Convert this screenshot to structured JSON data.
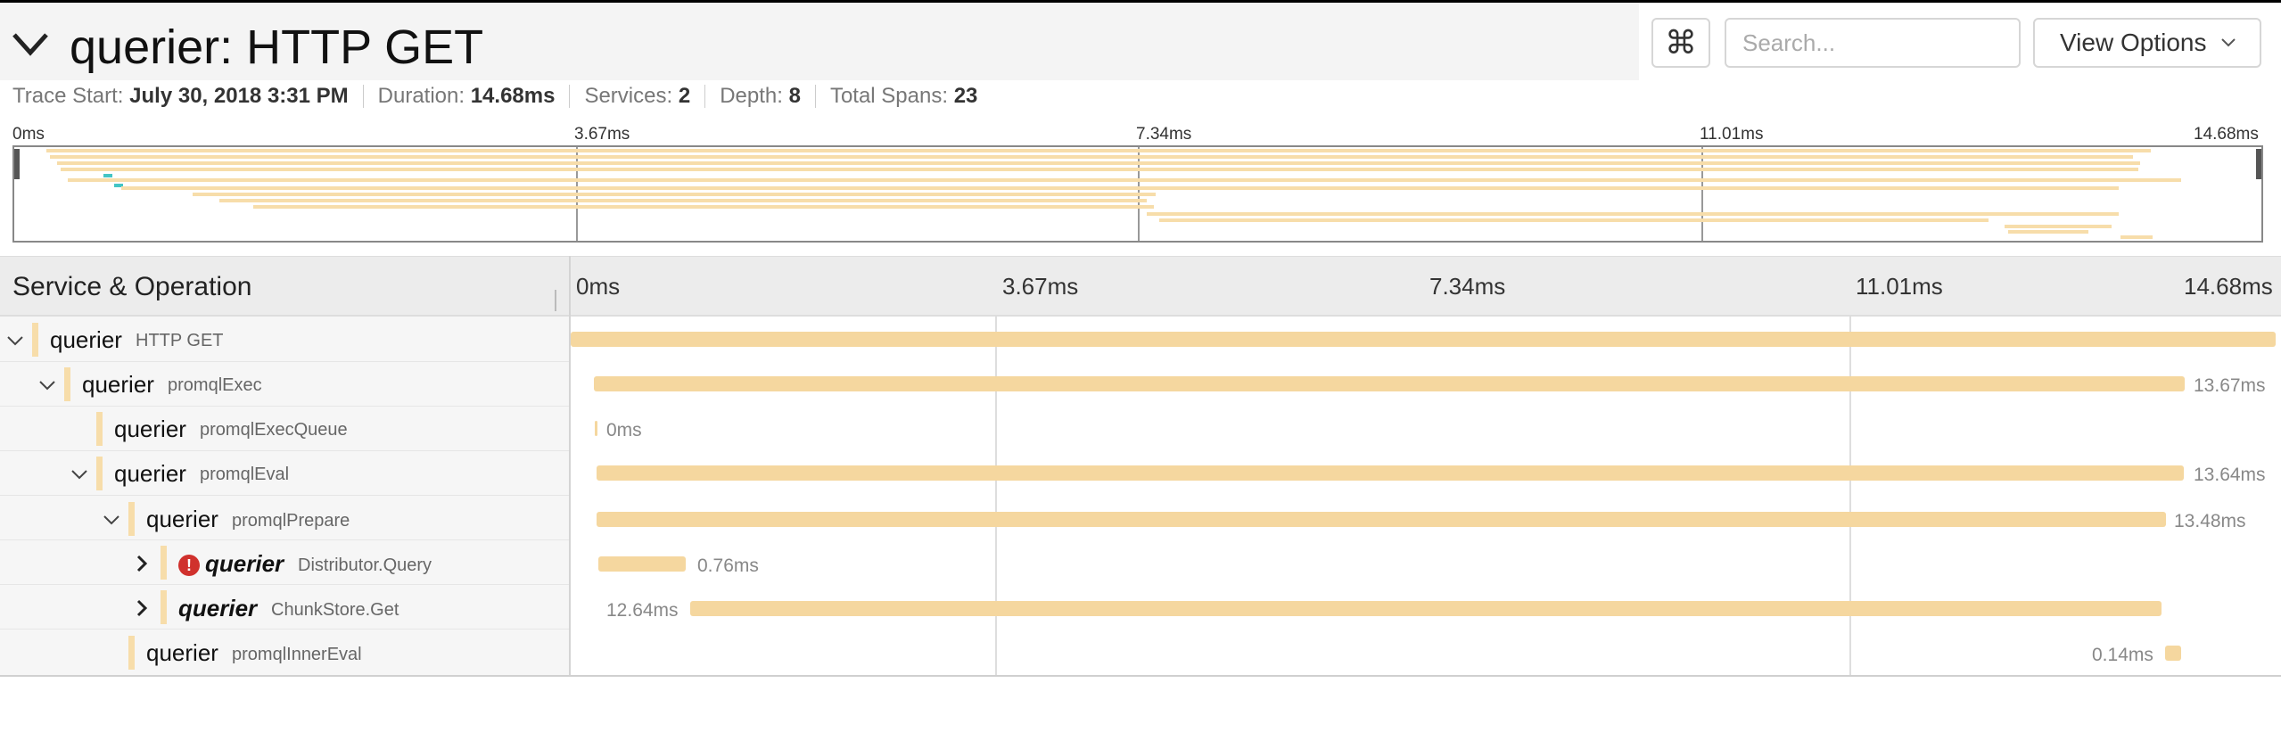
{
  "trace": {
    "title": "querier: HTTP GET",
    "meta": [
      {
        "label": "Trace Start:",
        "value": "July 30, 2018 3:31 PM"
      },
      {
        "label": "Duration:",
        "value": "14.68ms"
      },
      {
        "label": "Services:",
        "value": "2"
      },
      {
        "label": "Depth:",
        "value": "8"
      },
      {
        "label": "Total Spans:",
        "value": "23"
      }
    ]
  },
  "toolbar": {
    "keyboard_icon": "⌘",
    "search_placeholder": "Search...",
    "view_options_label": "View Options"
  },
  "minimap": {
    "ticks": [
      "0ms",
      "3.67ms",
      "7.34ms",
      "11.01ms",
      "14.68ms"
    ]
  },
  "timeline": {
    "column_title": "Service & Operation",
    "ticks": [
      "0ms",
      "3.67ms",
      "7.34ms",
      "11.01ms",
      "14.68ms"
    ],
    "rows": [
      {
        "service": "querier",
        "operation": "HTTP GET",
        "duration": ""
      },
      {
        "service": "querier",
        "operation": "promqlExec",
        "duration": "13.67ms"
      },
      {
        "service": "querier",
        "operation": "promqlExecQueue",
        "duration": "0ms"
      },
      {
        "service": "querier",
        "operation": "promqlEval",
        "duration": "13.64ms"
      },
      {
        "service": "querier",
        "operation": "promqlPrepare",
        "duration": "13.48ms"
      },
      {
        "service": "querier",
        "operation": "Distributor.Query",
        "duration": "0.76ms",
        "error_icon": "!"
      },
      {
        "service": "querier",
        "operation": "ChunkStore.Get",
        "duration": "12.64ms"
      },
      {
        "service": "querier",
        "operation": "promqlInnerEval",
        "duration": "0.14ms"
      }
    ]
  },
  "colors": {
    "span": "#f5d79f",
    "error": "#d0312d",
    "minimap_highlight": "#44c5c5"
  }
}
